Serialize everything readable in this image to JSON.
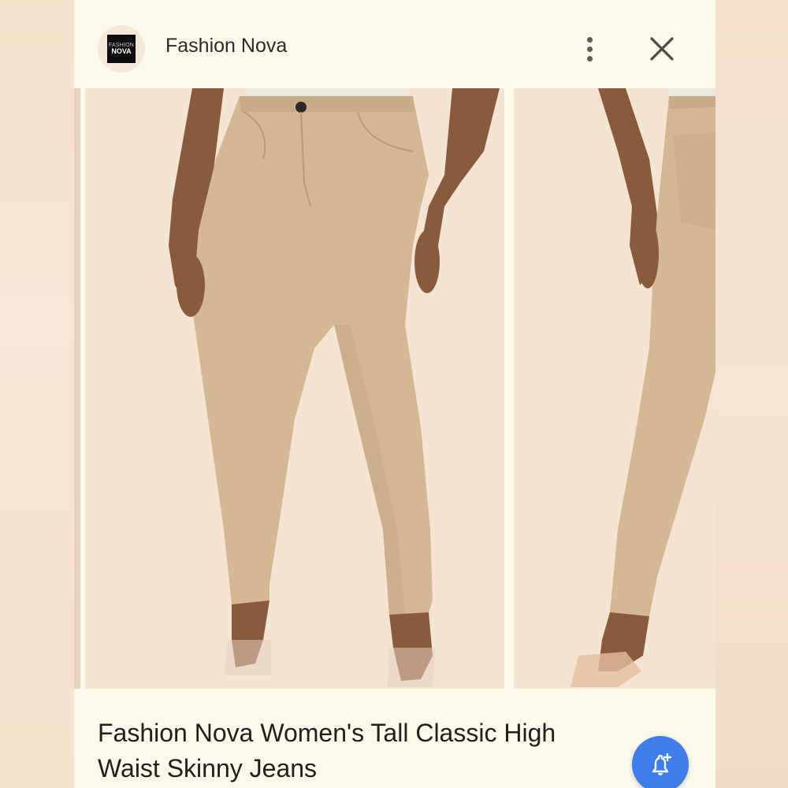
{
  "header": {
    "source_name": "Fashion Nova",
    "logo_text_top": "FASHION",
    "logo_text_bottom": "NOVA",
    "more_icon": "more-vert-icon",
    "close_icon": "close-icon"
  },
  "gallery": {
    "images": [
      {
        "description_icon": "product-image-front"
      },
      {
        "description_icon": "product-image-side"
      }
    ]
  },
  "product": {
    "title": "Fashion Nova Women's Tall Classic High Waist Skinny Jeans"
  },
  "fab": {
    "icon": "add-alert-icon",
    "color": "#3d7ee9"
  },
  "colors": {
    "card_background": "#fdf9ea",
    "pants": "#d4b896",
    "skin": "#8a5a3c"
  }
}
